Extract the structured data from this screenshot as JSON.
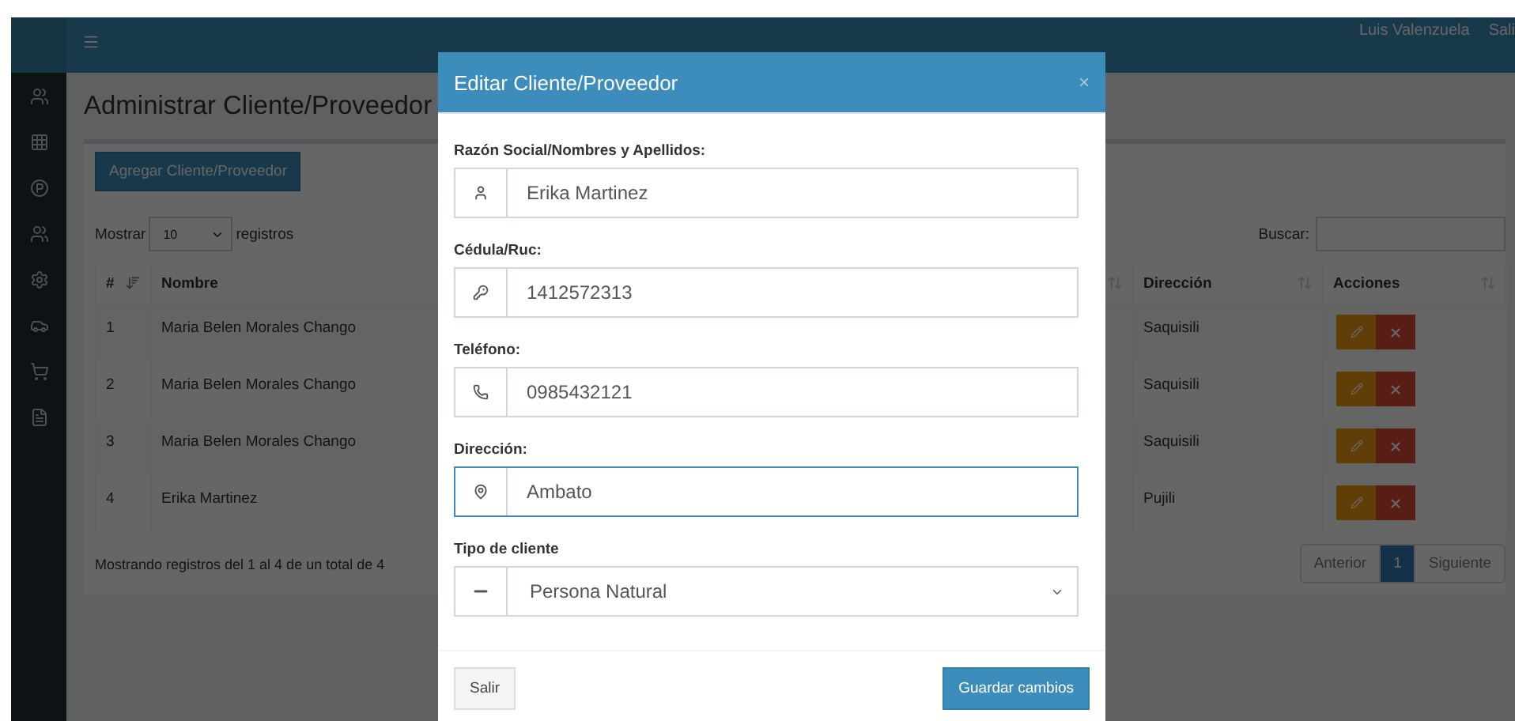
{
  "topbar": {
    "user": "Luis Valenzuela",
    "logout": "Sali"
  },
  "page": {
    "title": "Administrar Cliente/Proveedor",
    "add_button": "Agregar Cliente/Proveedor",
    "length": {
      "before": "Mostrar",
      "value": "10",
      "after": "registros"
    },
    "search": {
      "label": "Buscar:"
    },
    "columns": [
      {
        "label": "#",
        "sorted": true
      },
      {
        "label": "Nombre",
        "sorted": false
      },
      {
        "label": "Dirección",
        "sorted": false
      },
      {
        "label": "Acciones",
        "sorted": false
      }
    ],
    "rows": [
      {
        "number": "1",
        "name": "Maria Belen Morales Chango",
        "address": "Saquisili"
      },
      {
        "number": "2",
        "name": "Maria Belen Morales Chango",
        "address": "Saquisili"
      },
      {
        "number": "3",
        "name": "Maria Belen Morales Chango",
        "address": "Saquisili"
      },
      {
        "number": "4",
        "name": "Erika Martinez",
        "address": "Pujili"
      }
    ],
    "info": "Mostrando registros del 1 al 4 de un total de 4",
    "pagination": {
      "previous": "Anterior",
      "pages": [
        {
          "label": "1",
          "selected": true
        }
      ],
      "next": "Siguiente"
    }
  },
  "modal": {
    "title": "Editar Cliente/Proveedor",
    "close": "×",
    "fields": [
      {
        "kind": "input",
        "label": "Razón Social/Nombres y Apellidos:",
        "value": "Erika Martinez",
        "focused": false
      },
      {
        "kind": "input",
        "label": "Cédula/Ruc:",
        "value": "1412572313",
        "focused": false
      },
      {
        "kind": "input",
        "label": "Teléfono:",
        "value": "0985432121",
        "focused": false
      },
      {
        "kind": "input",
        "label": "Dirección:",
        "value": "Ambato",
        "focused": true
      },
      {
        "kind": "select",
        "label": "Tipo de cliente",
        "value": "Persona Natural",
        "focused": false
      }
    ],
    "buttons": [
      {
        "label": "Salir",
        "kind": "default"
      },
      {
        "label": "Guardar cambios",
        "kind": "primary"
      }
    ]
  }
}
